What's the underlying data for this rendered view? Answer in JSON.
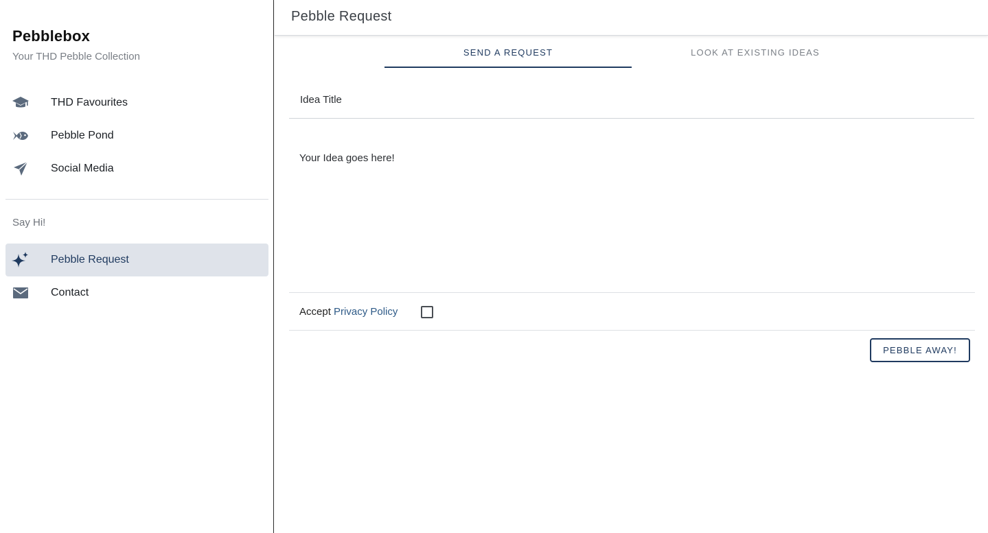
{
  "sidebar": {
    "brand_title": "Pebblebox",
    "brand_subtitle": "Your THD Pebble Collection",
    "items": [
      {
        "label": "THD Favourites",
        "icon": "graduation-cap-icon"
      },
      {
        "label": "Pebble Pond",
        "icon": "fish-icon"
      },
      {
        "label": "Social Media",
        "icon": "paper-plane-icon"
      }
    ],
    "section_label": "Say Hi!",
    "section_items": [
      {
        "label": "Pebble Request",
        "icon": "sparkles-icon",
        "active": true
      },
      {
        "label": "Contact",
        "icon": "envelope-icon"
      }
    ]
  },
  "header": {
    "title": "Pebble Request"
  },
  "tabs": [
    {
      "label": "SEND A REQUEST",
      "active": true
    },
    {
      "label": "LOOK AT EXISTING IDEAS",
      "active": false
    }
  ],
  "form": {
    "title_placeholder": "Idea Title",
    "idea_placeholder": "Your Idea goes here!",
    "privacy_prefix": "Accept ",
    "privacy_link": "Privacy Policy",
    "privacy_checked": false,
    "submit_label": "PEBBLE AWAY!"
  },
  "colors": {
    "accent": "#1f3a5f",
    "active_bg": "#dfe3ea",
    "icon": "#5b6a7d"
  }
}
